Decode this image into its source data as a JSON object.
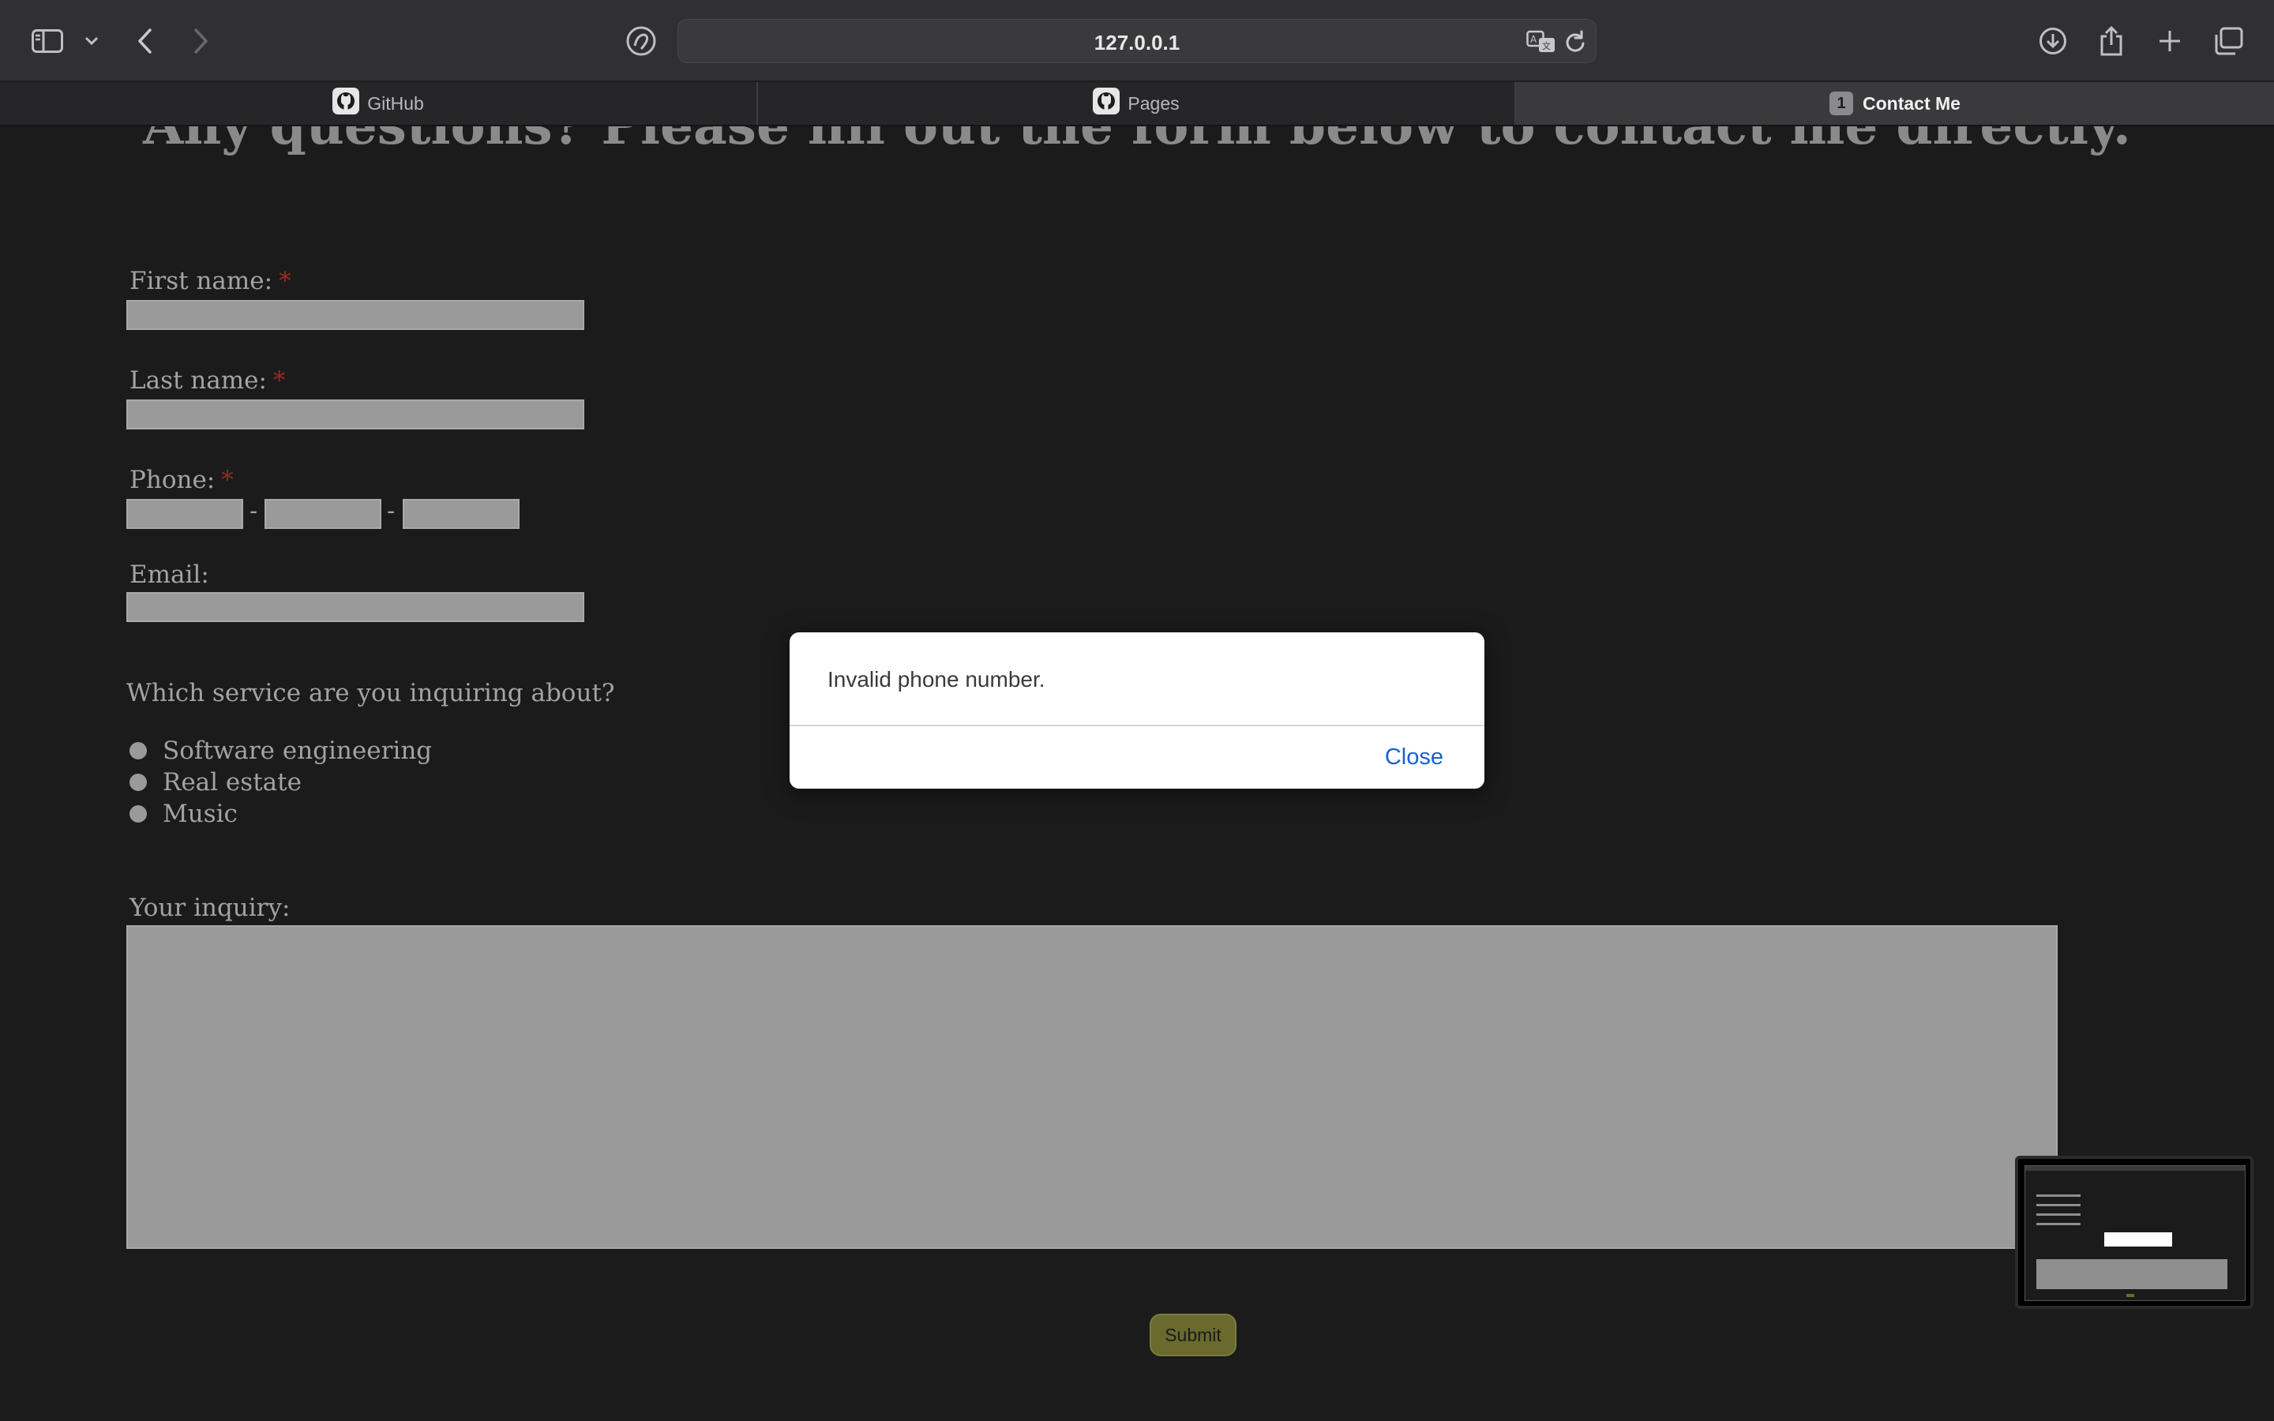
{
  "browser": {
    "url": "127.0.0.1",
    "tabs": [
      {
        "label": "GitHub",
        "icon": "github-icon",
        "active": false
      },
      {
        "label": "Pages",
        "icon": "github-icon",
        "active": false
      },
      {
        "label": "Contact Me",
        "badge": "1",
        "active": true
      }
    ],
    "toolbar_icons": [
      "sidebar-icon",
      "chevron-down-icon",
      "back-icon",
      "forward-icon",
      "privacy-shield-icon",
      "translate-icon",
      "reload-icon",
      "download-icon",
      "share-icon",
      "plus-icon",
      "tabs-overview-icon"
    ]
  },
  "page": {
    "heading": "Any questions? Please fill out the form below to contact me directly.",
    "form": {
      "first_name_label": "First name:",
      "last_name_label": "Last name:",
      "phone_label": "Phone:",
      "phone_separator": "-",
      "email_label": "Email:",
      "required_marker": "*",
      "service_question": "Which service are you inquiring about?",
      "services": [
        "Software engineering",
        "Real estate",
        "Music"
      ],
      "inquiry_label": "Your inquiry:",
      "submit_label": "Submit"
    }
  },
  "dialog": {
    "message": "Invalid phone number.",
    "close_label": "Close"
  },
  "colors": {
    "page_background": "#1b1b1b",
    "field_background": "#9a9a9a",
    "required_marker": "#9a2a20",
    "submit_background": "#6a6a2f",
    "dialog_link": "#1a5fd1"
  }
}
